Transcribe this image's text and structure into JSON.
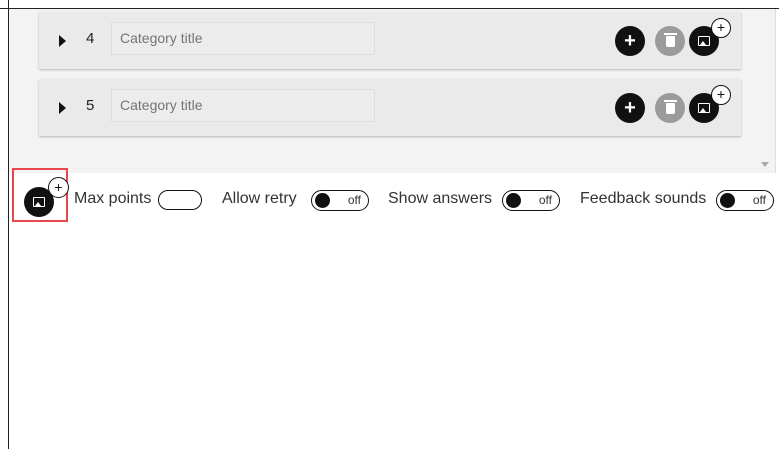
{
  "categories": [
    {
      "number": "4",
      "placeholder": "Category title"
    },
    {
      "number": "5",
      "placeholder": "Category title"
    }
  ],
  "icons": {
    "expand": "caret-right-icon",
    "add": "plus-icon",
    "delete": "trash-icon",
    "add_image": "image-plus-icon"
  },
  "row_button_plus": "+",
  "badge_plus": "+",
  "footer": {
    "max_points_label": "Max points",
    "allow_retry_label": "Allow retry",
    "allow_retry_state": "off",
    "show_answers_label": "Show answers",
    "show_answers_state": "off",
    "feedback_sounds_label": "Feedback sounds",
    "feedback_sounds_state": "off"
  },
  "colors": {
    "highlight": "#e8474c",
    "button": "#111111",
    "delete_button": "#9b9b9b",
    "row_bg": "#eaeaea"
  }
}
